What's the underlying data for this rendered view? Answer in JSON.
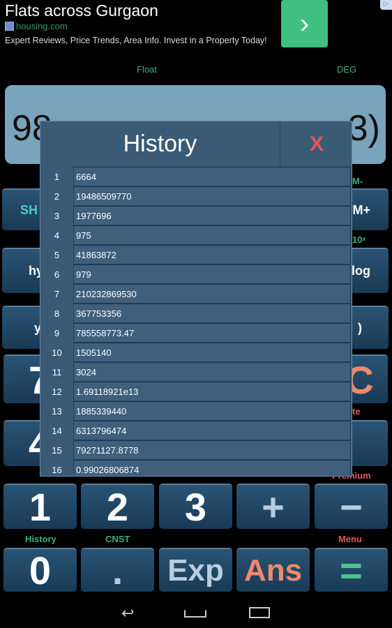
{
  "ad": {
    "title": "Flats across Gurgaon",
    "source": "housing.com",
    "description": "Expert Reviews, Price Trends, Area Info. Invest in a Property Today!",
    "go_icon": "chevron-right-icon",
    "adchoices_icon": "adchoices-icon"
  },
  "modes": {
    "number_format": "Float",
    "angle": "DEG"
  },
  "display": {
    "left_visible": "98",
    "right_visible": "3)"
  },
  "keys": {
    "r1": {
      "left": "SH",
      "right": "M+",
      "right_label": "M-"
    },
    "r2": {
      "left": "hy",
      "right": "log",
      "right_label": "10ˣ"
    },
    "r3": {
      "left": "y",
      "right": ")"
    },
    "r4": {
      "left": "7",
      "right": "C"
    },
    "r5": {
      "left": "4",
      "right_label": "te"
    },
    "r6": {
      "keys": [
        "1",
        "2",
        "3",
        "+",
        "−"
      ],
      "right_label": "Premium"
    },
    "r7": {
      "keys": [
        "0",
        ".",
        "Exp",
        "Ans",
        "="
      ],
      "labels": [
        "History",
        "CNST",
        "Menu"
      ]
    }
  },
  "history": {
    "title": "History",
    "close": "X",
    "items": [
      {
        "n": "1",
        "v": "6664"
      },
      {
        "n": "2",
        "v": "19486509770"
      },
      {
        "n": "3",
        "v": "1977696"
      },
      {
        "n": "4",
        "v": "975"
      },
      {
        "n": "5",
        "v": "41863872"
      },
      {
        "n": "6",
        "v": "979"
      },
      {
        "n": "7",
        "v": "210232869530"
      },
      {
        "n": "8",
        "v": "367753356"
      },
      {
        "n": "9",
        "v": "785558773.47"
      },
      {
        "n": "10",
        "v": "1505140"
      },
      {
        "n": "11",
        "v": "3024"
      },
      {
        "n": "12",
        "v": "1.69118921e13"
      },
      {
        "n": "13",
        "v": "1885339440"
      },
      {
        "n": "14",
        "v": "6313796474"
      },
      {
        "n": "15",
        "v": "79271127.8778"
      },
      {
        "n": "16",
        "v": "0.99026806874"
      }
    ]
  },
  "colors": {
    "accent_green": "#3fae80",
    "accent_red": "#e05a5a",
    "ans": "#f08a6a",
    "exp": "#b8cde0",
    "equals": "#4cc58e"
  }
}
